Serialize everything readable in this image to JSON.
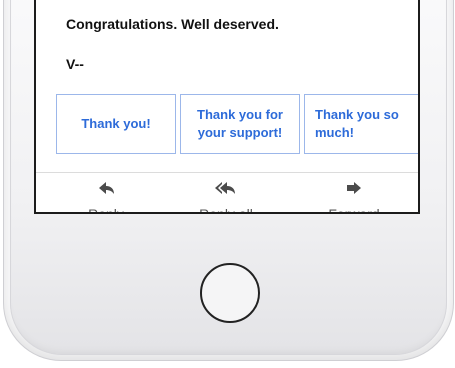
{
  "email": {
    "body_line_1": "Congratulations. Well deserved.",
    "signature": "V--"
  },
  "smart_replies": [
    {
      "text": "Thank you!"
    },
    {
      "line1": "Thank you for",
      "line2": "your support!"
    },
    {
      "line1": "Thank you so",
      "line2": "much!"
    }
  ],
  "actions": {
    "reply": {
      "label": "Reply",
      "icon": "reply-icon"
    },
    "reply_all": {
      "label": "Reply all",
      "icon": "reply-all-icon"
    },
    "forward": {
      "label": "Forward",
      "icon": "forward-icon"
    }
  },
  "colors": {
    "chip_border": "#9cb7ea",
    "chip_text": "#2d6bd9",
    "action_text": "#555555"
  }
}
